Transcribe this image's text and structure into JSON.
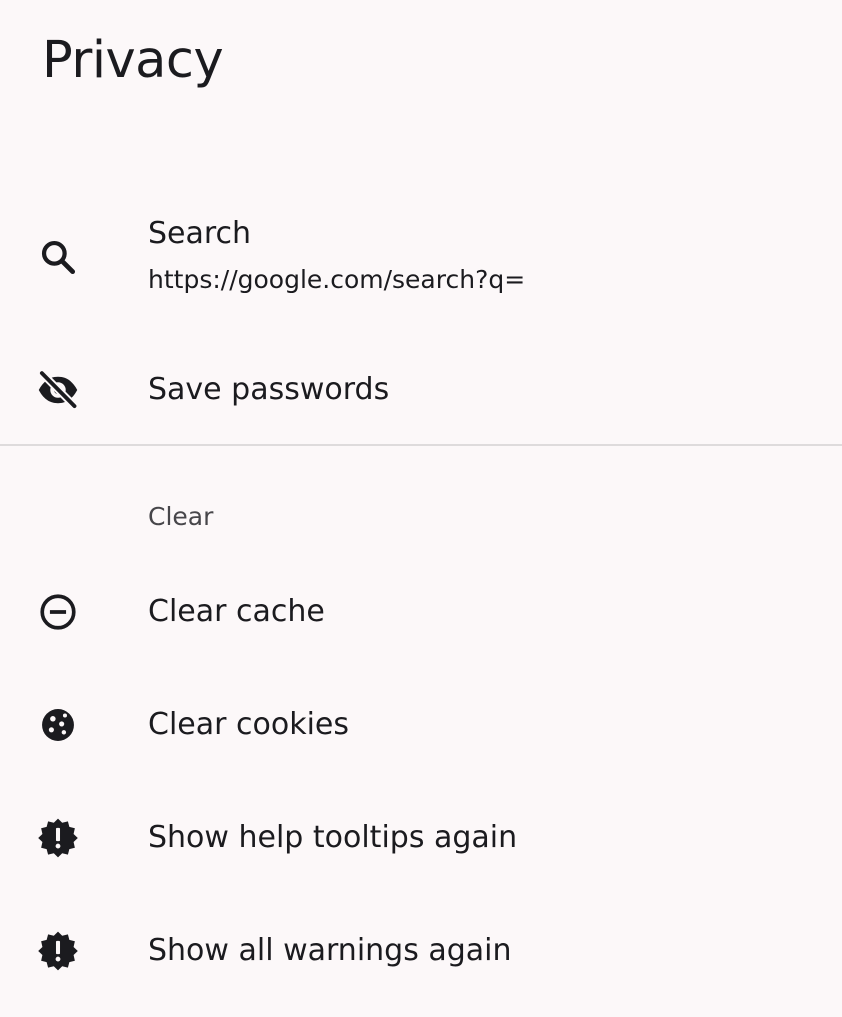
{
  "page": {
    "title": "Privacy"
  },
  "items": {
    "search": {
      "title": "Search",
      "subtitle": "https://google.com/search?q=",
      "icon": "search-icon"
    },
    "save_passwords": {
      "title": "Save passwords",
      "icon": "eye-off-icon"
    }
  },
  "clear_section": {
    "header": "Clear",
    "items": {
      "clear_cache": {
        "title": "Clear cache",
        "icon": "minus-circle-icon"
      },
      "clear_cookies": {
        "title": "Clear cookies",
        "icon": "cookie-icon"
      },
      "show_help_tooltips": {
        "title": "Show help tooltips again",
        "icon": "alert-badge-icon"
      },
      "show_all_warnings": {
        "title": "Show all warnings again",
        "icon": "alert-badge-icon"
      }
    }
  },
  "colors": {
    "background": "#fcf8f9",
    "text": "#1b1b1f",
    "secondary_text": "#47464a",
    "divider": "#dedbdc"
  }
}
